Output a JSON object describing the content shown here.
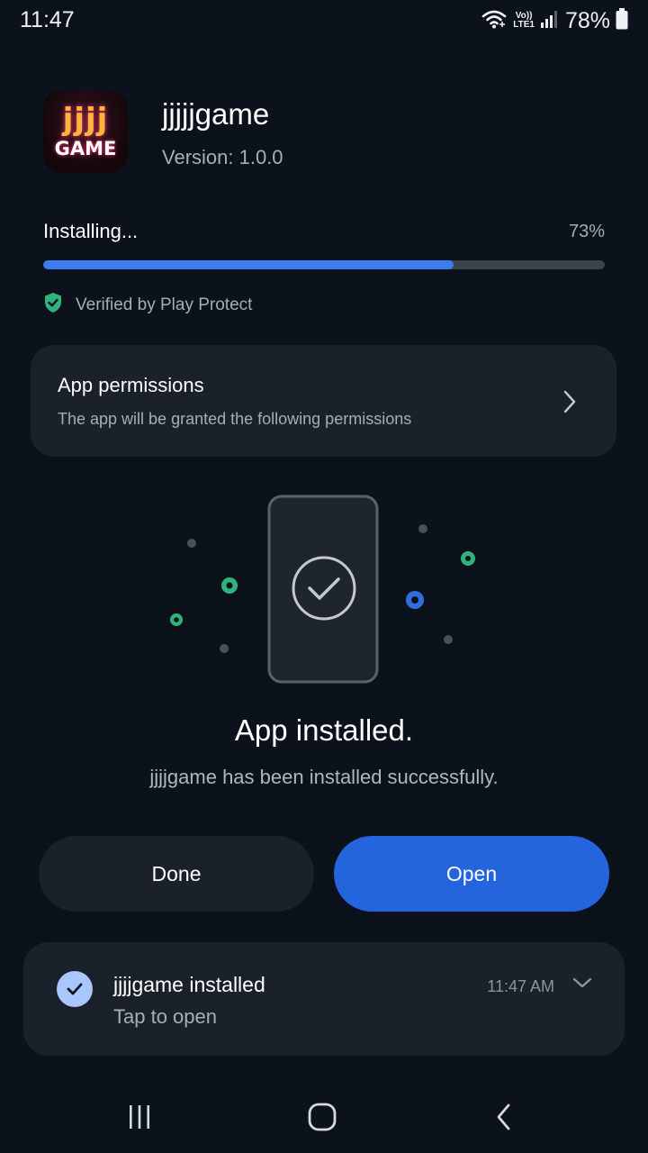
{
  "status_bar": {
    "time": "11:47",
    "network_badge_top": "Vo))",
    "network_badge_bottom": "LTE1",
    "battery": "78%",
    "icons": [
      "wifi-icon",
      "signal-icon",
      "battery-icon"
    ]
  },
  "app": {
    "icon_text_top": "jjjj",
    "icon_text_bottom": "GAME",
    "name": "jjjjjgame",
    "version": "Version: 1.0.0"
  },
  "progress": {
    "label": "Installing...",
    "percent_text": "73%",
    "percent": 73
  },
  "verified": {
    "text": "Verified by Play Protect",
    "icon": "shield-check-icon"
  },
  "permissions": {
    "title": "App permissions",
    "subtitle": "The app will be granted the following permissions",
    "icon": "chevron-right-icon"
  },
  "result": {
    "title": "App installed.",
    "subtitle": "jjjjgame has been installed successfully."
  },
  "buttons": {
    "done": "Done",
    "open": "Open"
  },
  "notification": {
    "title": "jjjjgame installed",
    "subtitle": "Tap to open",
    "time": "11:47 AM",
    "icon": "check-circle-icon"
  },
  "nav_bar": {
    "icons": [
      "recents-icon",
      "home-icon",
      "back-icon"
    ]
  },
  "colors": {
    "background": "#0c121c",
    "card": "#1b212b",
    "accent_blue": "#2465de",
    "progress_blue": "#3b7cf0",
    "play_protect_green": "#2fb37a"
  }
}
